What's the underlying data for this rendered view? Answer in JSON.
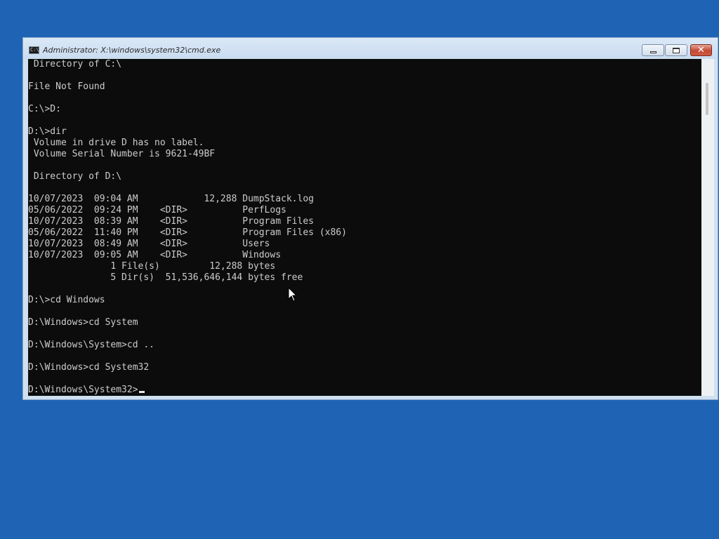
{
  "window": {
    "title": "Administrator: X:\\windows\\system32\\cmd.exe",
    "icon": "cmd-icon",
    "icon_text": "C:\\",
    "controls": {
      "minimize": "minimize-icon",
      "maximize": "maximize-icon",
      "close": "close-icon",
      "close_glyph": "✕"
    }
  },
  "console": {
    "lines": [
      " Directory of C:\\",
      "",
      "File Not Found",
      "",
      "C:\\>D:",
      "",
      "D:\\>dir",
      " Volume in drive D has no label.",
      " Volume Serial Number is 9621-49BF",
      "",
      " Directory of D:\\",
      "",
      "10/07/2023  09:04 AM            12,288 DumpStack.log",
      "05/06/2022  09:24 PM    <DIR>          PerfLogs",
      "10/07/2023  08:39 AM    <DIR>          Program Files",
      "05/06/2022  11:40 PM    <DIR>          Program Files (x86)",
      "10/07/2023  08:49 AM    <DIR>          Users",
      "10/07/2023  09:05 AM    <DIR>          Windows",
      "               1 File(s)         12,288 bytes",
      "               5 Dir(s)  51,536,646,144 bytes free",
      "",
      "D:\\>cd Windows",
      "",
      "D:\\Windows>cd System",
      "",
      "D:\\Windows\\System>cd ..",
      "",
      "D:\\Windows>cd System32",
      ""
    ],
    "prompt": "D:\\Windows\\System32>",
    "input": ""
  },
  "colors": {
    "desktop": "#1f64b4",
    "console_bg": "#0c0c0c",
    "console_fg": "#cccccc"
  }
}
